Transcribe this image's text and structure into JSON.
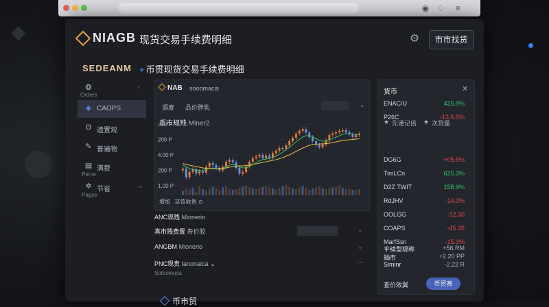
{
  "app": {
    "brand": "NIAGB",
    "title": "现货交易手续费明细",
    "header_button": "市市找货",
    "sub_brand": "SEDEANM",
    "sub_tab": "币贯现货交易手续费明细"
  },
  "sidebar": {
    "items": [
      {
        "label": "",
        "caption": "Orders",
        "icon": "shield-icon"
      },
      {
        "label": "CAOPS",
        "caption": "",
        "icon": "location-icon"
      },
      {
        "label": "遗置观",
        "caption": "",
        "icon": "search-icon"
      },
      {
        "label": "普遍物",
        "caption": "",
        "icon": "tools-icon"
      },
      {
        "label": "满费",
        "caption": "Perce",
        "icon": "wallet-icon"
      },
      {
        "label": "节省",
        "caption": "Pagse",
        "icon": "gear-icon"
      }
    ]
  },
  "center": {
    "card_title": "NAB",
    "card_sub": "sooomacis",
    "row_a": "调度",
    "row_b": "品价胖乳",
    "chart_label": "币市规贱",
    "chart_label_sub": "Miner2",
    "y_ticks": [
      "300 P",
      "200 P",
      "4.00 P",
      "200 P",
      "1.00 P"
    ],
    "footer_a": "增加",
    "footer_b": "这信收贵",
    "row1": "ANC现贱",
    "row1_sub": "Mionerio",
    "row2": "真市贱费置",
    "row2_sub": "寿价胶",
    "row3": "ANGBM",
    "row3_sub": "Mionerio",
    "row4": "PNC现贵",
    "row4_sub": "Ianonaica",
    "row5": "Sotoolousa",
    "bottom_tab": "币市贸"
  },
  "right": {
    "title": "货币",
    "tickers": [
      {
        "name": "ENAC/U",
        "value": "425.9%",
        "color": "#35c46a"
      },
      {
        "name": "P26C",
        "value": "-13.5.5%",
        "color": "#e5484d"
      },
      {
        "name": "DG6G",
        "value": "+05.5%",
        "color": "#e5484d"
      },
      {
        "name": "TimLCn",
        "value": "625.3%",
        "color": "#35c46a"
      },
      {
        "name": "D2Z TWIT",
        "value": "158.9%",
        "color": "#35c46a"
      },
      {
        "name": "RdJHV",
        "value": "-14.0%",
        "color": "#e5484d"
      },
      {
        "name": "OOLGG",
        "value": "-12.30",
        "color": "#e5484d"
      },
      {
        "name": "COAPS",
        "value": "-45.35",
        "color": "#e5484d"
      },
      {
        "name": "MarfSsn",
        "value": "-15.3%",
        "color": "#e5484d"
      }
    ],
    "stars_a": "先谨记倍",
    "stars_b": "次货量",
    "summary": [
      {
        "l": "平续型规称",
        "r": "+56.RM"
      },
      {
        "l": "抽市",
        "r": "+2.20 PP"
      },
      {
        "l": "Siminr",
        "r": "-2.22 R"
      }
    ],
    "button_label": "查价效翼",
    "button": "币贸赛"
  },
  "chart_data": {
    "type": "line",
    "x": [
      1,
      2,
      3,
      4,
      5,
      6,
      7,
      8,
      9,
      10,
      11,
      12,
      13,
      14,
      15,
      16,
      17,
      18,
      19,
      20,
      21,
      22,
      23,
      24,
      25,
      26,
      27,
      28,
      29,
      30,
      31,
      32,
      33,
      34,
      35,
      36,
      37,
      38,
      39,
      40,
      41,
      42,
      43,
      44,
      45,
      46,
      47,
      48,
      49,
      50,
      51,
      52,
      53,
      54
    ],
    "series": [
      {
        "values": [
          170,
          145,
          160,
          168,
          155,
          162,
          158,
          175,
          186,
          180,
          172,
          165,
          175,
          190,
          195,
          188,
          172,
          155,
          160,
          176,
          190,
          200,
          205,
          210,
          200,
          208,
          202,
          215,
          222,
          230,
          228,
          238,
          250,
          260,
          272,
          280,
          285,
          275,
          262,
          250,
          240,
          232,
          240,
          252,
          268,
          272,
          276,
          280,
          282,
          276,
          270,
          262,
          268,
          272
        ]
      },
      {
        "values": [
          180,
          175,
          170,
          168,
          165,
          165,
          163,
          167,
          170,
          172,
          170,
          168,
          170,
          176,
          180,
          182,
          180,
          175,
          172,
          172,
          176,
          182,
          188,
          193,
          196,
          198,
          200,
          202,
          206,
          212,
          218,
          225,
          232,
          240,
          248,
          255,
          262,
          266,
          266,
          263,
          258,
          252,
          250,
          250,
          254,
          258,
          262,
          266,
          270,
          272,
          272,
          270,
          270,
          270
        ]
      },
      {
        "values": [
          185,
          182,
          180,
          178,
          176,
          174,
          172,
          170,
          170,
          170,
          170,
          170,
          170,
          172,
          174,
          176,
          177,
          178,
          178,
          179,
          180,
          182,
          184,
          186,
          188,
          190,
          192,
          194,
          196,
          199,
          202,
          206,
          210,
          215,
          220,
          225,
          230,
          234,
          238,
          240,
          241,
          242,
          242,
          243,
          244,
          246,
          248,
          250,
          252,
          253,
          254,
          255,
          256,
          257
        ]
      }
    ],
    "volume": [
      14,
      22,
      18,
      25,
      12,
      30,
      20,
      16,
      22,
      28,
      24,
      18,
      26,
      30,
      22,
      18,
      20,
      24,
      28,
      32,
      26,
      22,
      20,
      24,
      28,
      30,
      26,
      22,
      18,
      24,
      30,
      34,
      28,
      22,
      20,
      26,
      30,
      24,
      18,
      22,
      26,
      28,
      24,
      20,
      22,
      26,
      28,
      30,
      24,
      20,
      22,
      18,
      16,
      20
    ]
  }
}
